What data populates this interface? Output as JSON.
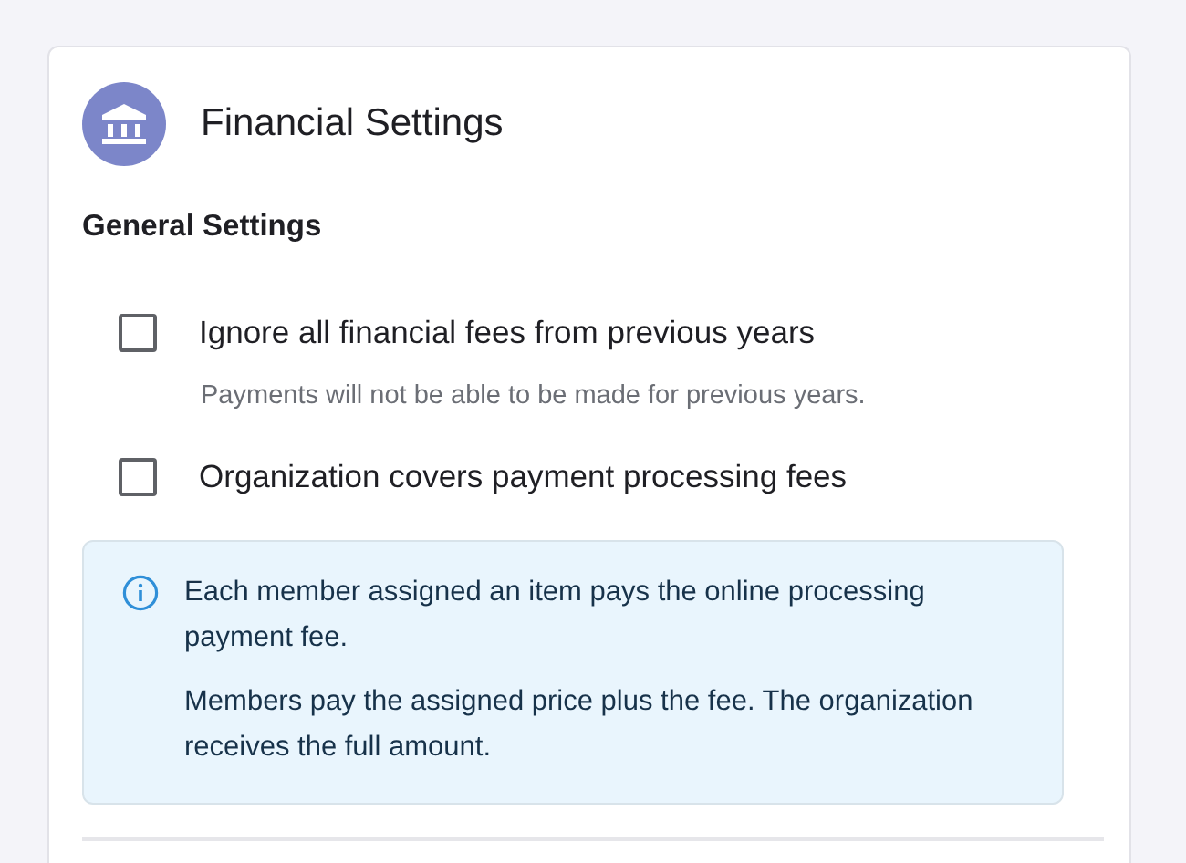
{
  "card": {
    "title": "Financial Settings"
  },
  "section": {
    "heading": "General Settings"
  },
  "options": [
    {
      "label": "Ignore all financial fees from previous years",
      "checked": false,
      "description": "Payments will not be able to be made for previous years."
    },
    {
      "label": "Organization covers payment processing fees",
      "checked": false
    }
  ],
  "info": {
    "paragraphs": [
      "Each member assigned an item pays the online processing payment fee.",
      "Members pay the assigned price plus the fee. The organization receives the full amount."
    ]
  }
}
